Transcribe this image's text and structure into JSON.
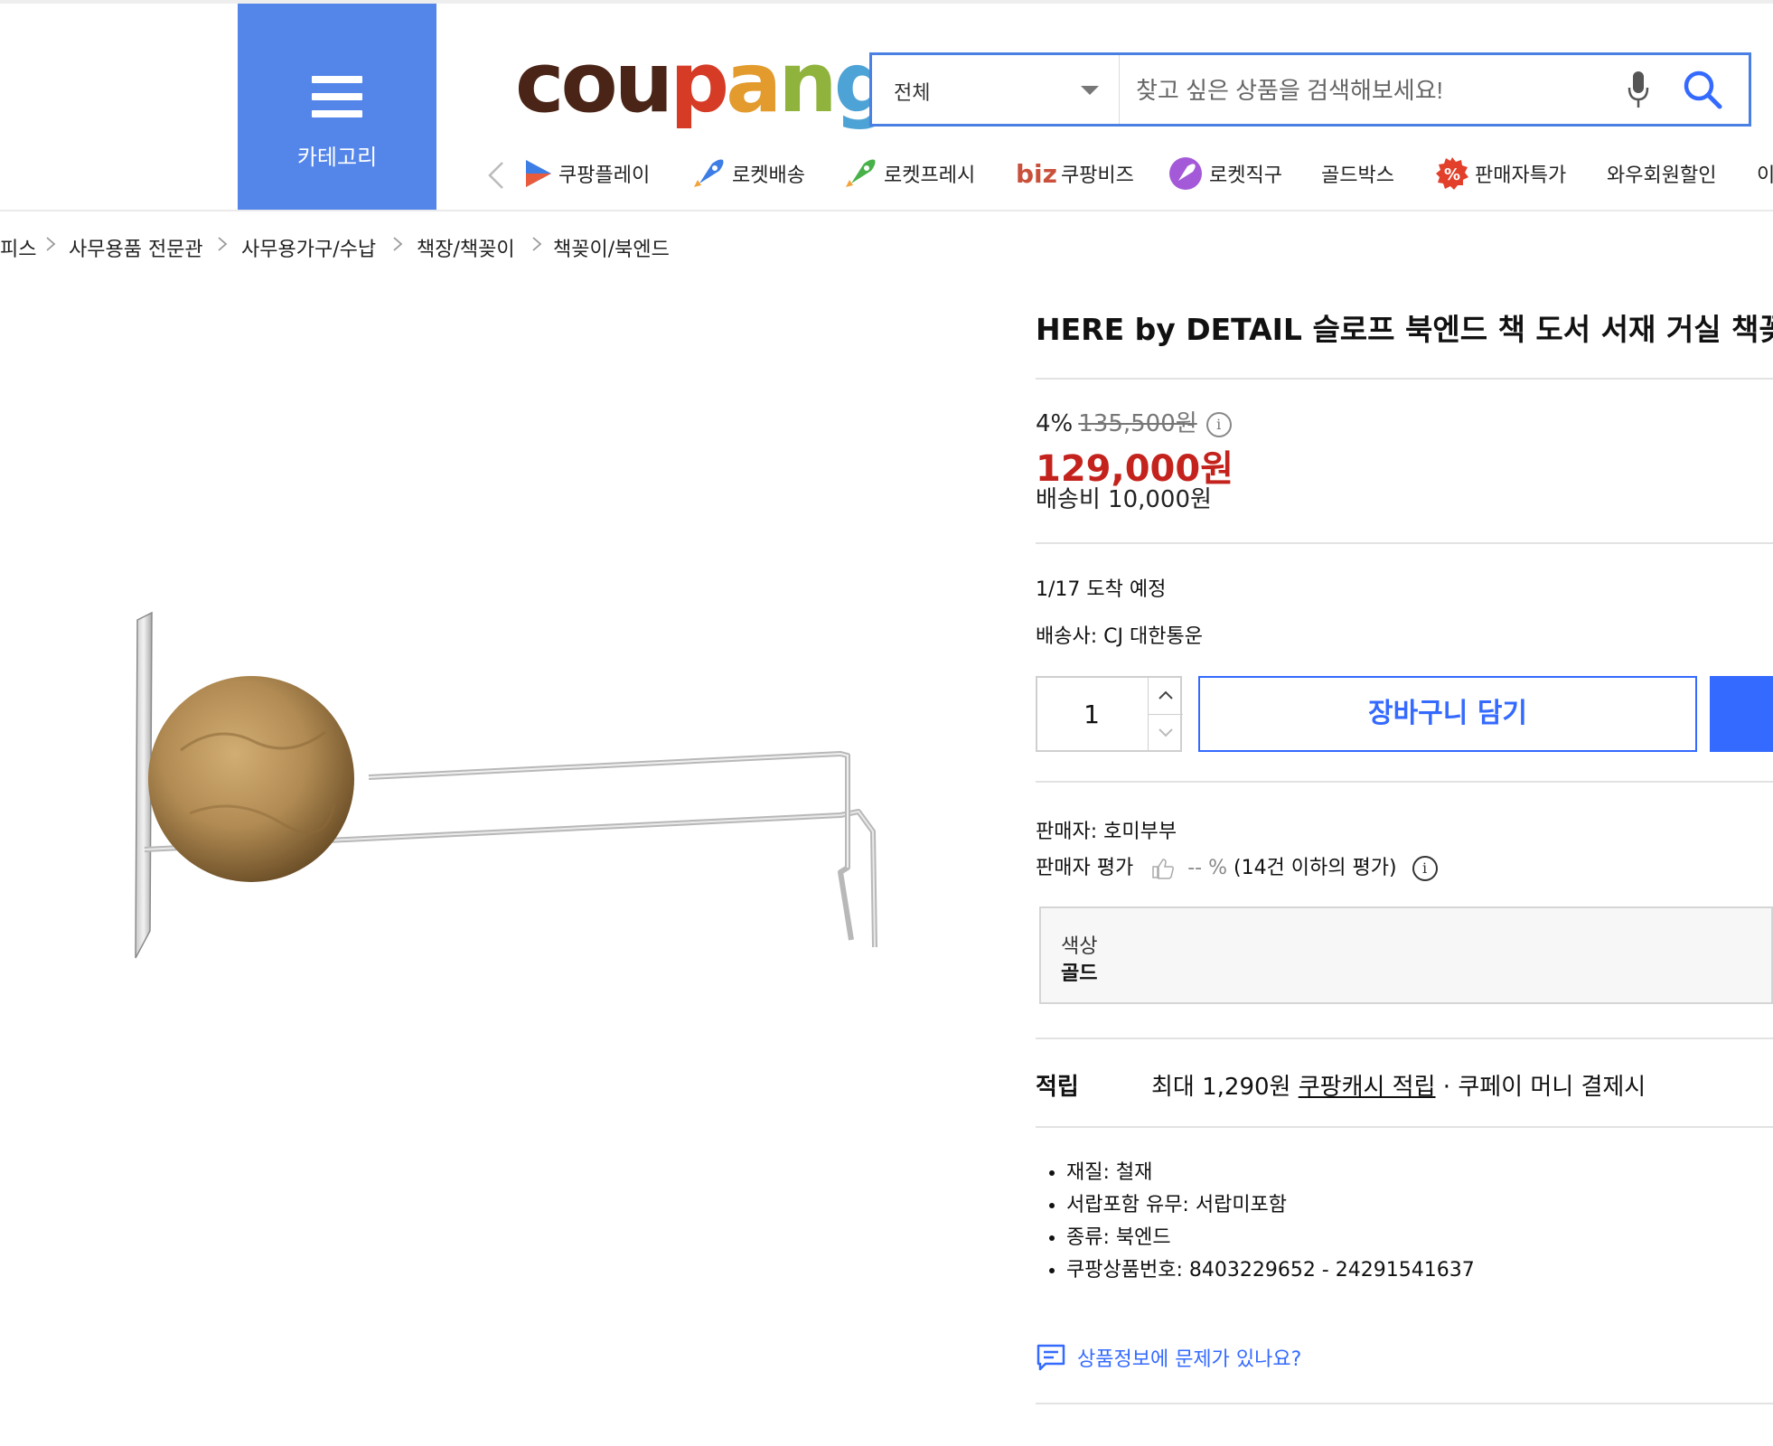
{
  "header": {
    "category_label": "카테고리",
    "logo": [
      "c",
      "o",
      "u",
      "p",
      "a",
      "n",
      "g"
    ],
    "search": {
      "scope": "전체",
      "placeholder": "찾고 싶은 상품을 검색해보세요!"
    }
  },
  "nav": {
    "items": [
      {
        "label": "쿠팡플레이",
        "icon": "play-icon"
      },
      {
        "label": "로켓배송",
        "icon": "rocket-icon"
      },
      {
        "label": "로켓프레시",
        "icon": "fresh-rocket-icon"
      },
      {
        "label": "쿠팡비즈",
        "icon": "biz-icon",
        "prefix": "biz"
      },
      {
        "label": "로켓직구",
        "icon": "global-rocket-icon"
      },
      {
        "label": "골드박스",
        "icon": ""
      },
      {
        "label": "판매자특가",
        "icon": "percent-badge-icon"
      },
      {
        "label": "와우회원할인",
        "icon": ""
      },
      {
        "label": "이",
        "icon": ""
      }
    ]
  },
  "breadcrumb": [
    "피스",
    "사무용품 전문관",
    "사무용가구/수납",
    "책장/책꽂이",
    "책꽂이/북엔드"
  ],
  "product": {
    "title": "HERE by DETAIL 슬로프 북엔드 책 도서 서재 거실 책꽂이",
    "discount": "4%",
    "original_price": "135,500원",
    "sale_price": "129,000원",
    "shipping_fee": "배송비 10,000원",
    "eta": "1/17 도착 예정",
    "carrier": "배송사: CJ 대한통운",
    "quantity": "1",
    "cart_label": "장바구니 담기",
    "seller": "판매자: 호미부부",
    "rating_label": "판매자 평가",
    "rating_value": "-- %",
    "rating_note": "(14건 이하의 평가)",
    "option": {
      "key": "색상",
      "value": "골드"
    },
    "reward": {
      "heading": "적립",
      "prefix": "최대 1,290원",
      "link": "쿠팡캐시 적립",
      "suffix": "· 쿠페이 머니 결제시"
    },
    "specs": [
      "재질: 철재",
      "서랍포함 유무: 서랍미포함",
      "종류: 북엔드",
      "쿠팡상품번호: 8403229652 - 24291541637"
    ],
    "report_link": "상품정보에 문제가 있나요?"
  },
  "colors": {
    "brand_blue": "#346aff",
    "category_blue": "#5486ea",
    "price_red": "#c4231d"
  }
}
